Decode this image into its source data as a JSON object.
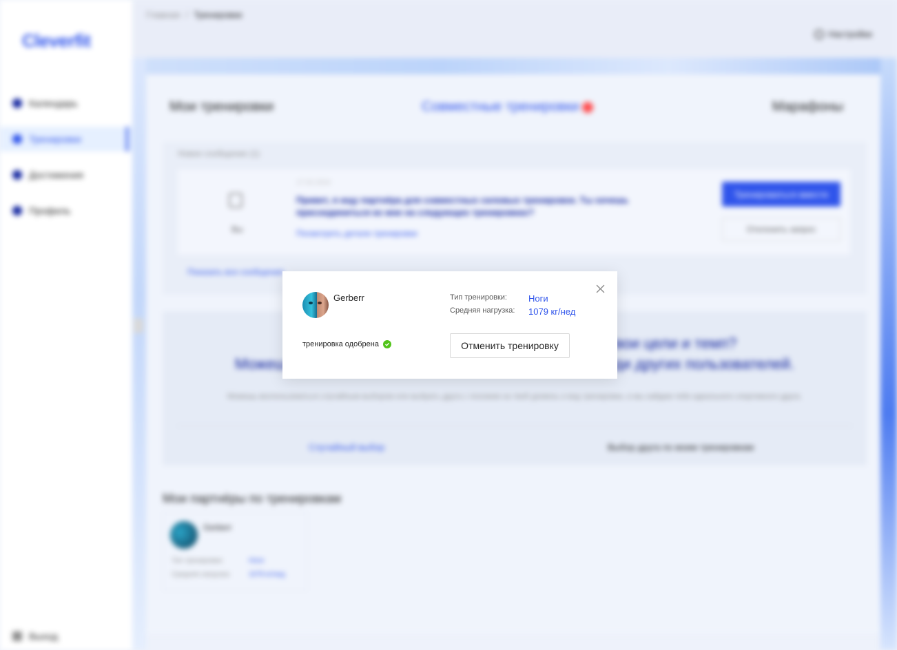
{
  "sidebar": {
    "logo": "Cleverfit",
    "items": [
      {
        "label": "Календарь",
        "icon": "calendar-icon"
      },
      {
        "label": "Тренировки",
        "icon": "heart-icon",
        "active": true
      },
      {
        "label": "Достижения",
        "icon": "trophy-icon"
      },
      {
        "label": "Профиль",
        "icon": "user-icon"
      }
    ],
    "exit_label": "Выход"
  },
  "header": {
    "breadcrumb": [
      "Главная",
      "Тренировки"
    ],
    "settings_label": "Настройки"
  },
  "tabs": [
    {
      "label": "Мои тренировки"
    },
    {
      "label": "Совместные тренировки",
      "active": true
    },
    {
      "label": "Марафоны"
    }
  ],
  "messages": {
    "title": "Новое сообщение (1)",
    "you_label": "Вы",
    "date": "17.02.2024",
    "text": "Привет, я ищу партнёра для совместных силовых тренировок. Ты хочешь присоединиться ко мне на следующих тренировках?",
    "details_link": "Посмотреть детали тренировки",
    "accept_label": "Тренироваться вместе",
    "decline_label": "Отклонить запрос",
    "show_all": "Показать все сообщения"
  },
  "promo": {
    "title_line1": "Хочешь тренироваться с тем, кто разделяет твои цели и темп?",
    "title_line2": "Можешь найти друга для совместных тренировок среди других пользователей.",
    "subtitle": "Можешь воспользоваться случайным выбором или выбрать друга с похожим на твой уровень и вид тренировки, и мы найдем тебе идеального спортивного друга.",
    "random_label": "Случайный выбор",
    "choose_label": "Выбор друга по моим тренировкам"
  },
  "partners": {
    "title": "Мои партнёры по тренировкам",
    "card": {
      "name": "Gerberr",
      "type_label": "Тип тренировки:",
      "type_value": "Ноги",
      "load_label": "Средняя нагрузка:",
      "load_value": "1079 кг/нед"
    }
  },
  "modal": {
    "name": "Gerberr",
    "type_label": "Тип тренировки:",
    "type_value": "Ноги",
    "load_label": "Средняя нагрузка:",
    "load_value": "1079 кг/нед",
    "status": "тренировка одобрена",
    "cancel_button": "Отменить тренировку"
  },
  "colors": {
    "primary": "#2f54eb",
    "dark_blue": "#10239e",
    "success": "#52c41a",
    "danger": "#ff4d4f"
  }
}
